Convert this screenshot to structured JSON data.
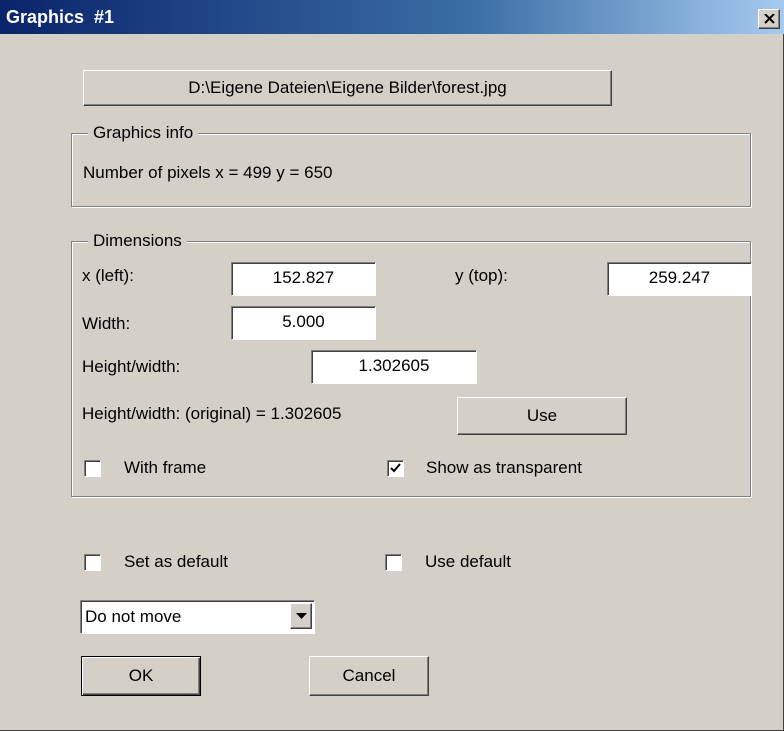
{
  "window": {
    "title": "Graphics  #1"
  },
  "file_button": {
    "label": "D:\\Eigene Dateien\\Eigene Bilder\\forest.jpg"
  },
  "graphics_info": {
    "legend": "Graphics info",
    "pixels_text": "Number of pixels x = 499  y = 650"
  },
  "dimensions": {
    "legend": "Dimensions",
    "x_label": "x (left):",
    "x_value": "152.827",
    "y_label": "y (top):",
    "y_value": "259.247",
    "width_label": "Width:",
    "width_value": "5.000",
    "hw_label": "Height/width:",
    "hw_value": "1.302605",
    "hw_original_text": "Height/width: (original) = 1.302605",
    "use_button": "Use",
    "with_frame": {
      "label": "With frame",
      "checked": false
    },
    "transparent": {
      "label": "Show as transparent",
      "checked": true
    }
  },
  "defaults": {
    "set_default": {
      "label": "Set as default",
      "checked": false
    },
    "use_default": {
      "label": "Use default",
      "checked": false
    }
  },
  "move_select": {
    "value": "Do not move"
  },
  "buttons": {
    "ok": "OK",
    "cancel": "Cancel"
  },
  "colors": {
    "titlebar_start": "#0a246a",
    "titlebar_end": "#a6caf0",
    "face": "#d4d0c8"
  }
}
